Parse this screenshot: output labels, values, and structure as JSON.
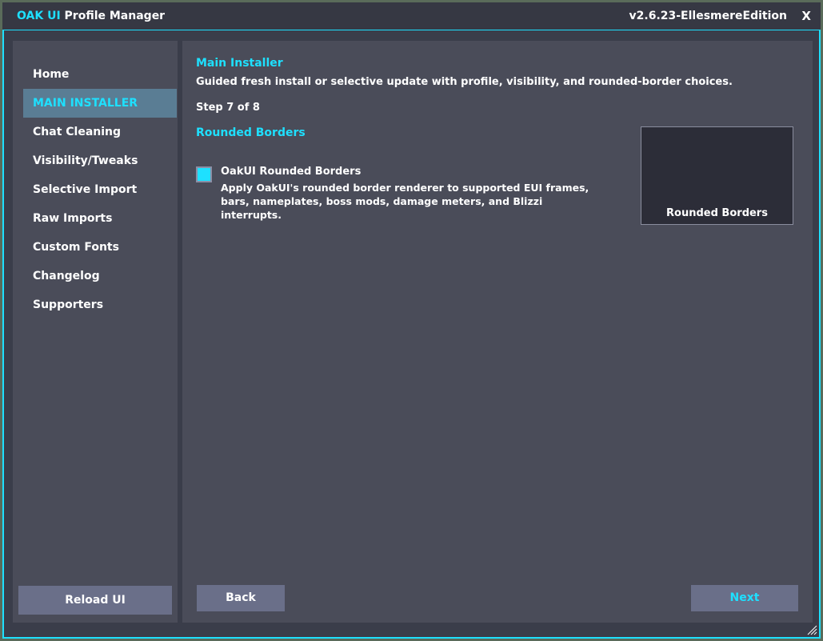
{
  "window": {
    "title_brand": "OAK UI",
    "title_rest": " Profile Manager",
    "version": "v2.6.23-EllesmereEdition",
    "close_label": "X"
  },
  "sidebar": {
    "items": [
      {
        "label": "Home"
      },
      {
        "label": "MAIN INSTALLER"
      },
      {
        "label": "Chat Cleaning"
      },
      {
        "label": "Visibility/Tweaks"
      },
      {
        "label": "Selective Import"
      },
      {
        "label": "Raw Imports"
      },
      {
        "label": "Custom Fonts"
      },
      {
        "label": "Changelog"
      },
      {
        "label": "Supporters"
      }
    ],
    "active_index": 1,
    "reload_label": "Reload UI"
  },
  "main": {
    "section_title": "Main Installer",
    "description": "Guided fresh install or selective update with profile, visibility, and rounded-border choices.",
    "step": "Step 7 of 8",
    "subsection_title": "Rounded Borders",
    "option": {
      "label": "OakUI Rounded Borders",
      "description": "Apply OakUI's rounded border renderer to supported EUI frames, bars, nameplates, boss mods, damage meters, and Blizzi interrupts.",
      "checked": true
    },
    "preview_label": "Rounded Borders",
    "back_label": "Back",
    "next_label": "Next"
  },
  "colors": {
    "accent": "#1ee0ff",
    "panel": "#4a4c59",
    "button": "#6a6f89",
    "active_nav": "#5a7d94"
  }
}
